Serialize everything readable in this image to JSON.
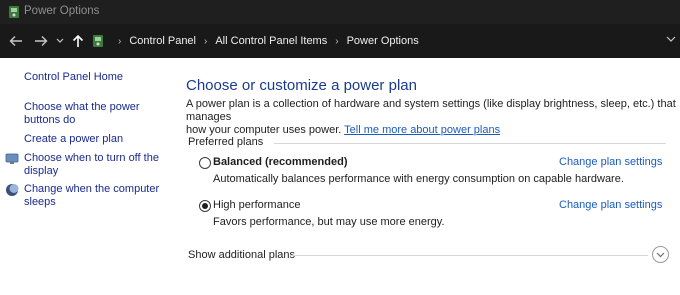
{
  "window": {
    "title": "Power Options"
  },
  "address_bar": {
    "crumbs": [
      "Control Panel",
      "All Control Panel Items",
      "Power Options"
    ]
  },
  "left_pane": {
    "home": "Control Panel Home",
    "links": [
      {
        "label_line1": "Choose what the power",
        "label_line2": "buttons do"
      },
      {
        "label_line1": "Create a power plan",
        "label_line2": ""
      },
      {
        "label_line1": "Choose when to turn off the",
        "label_line2": "display",
        "icon": "display-icon"
      },
      {
        "label_line1": "Change when the computer",
        "label_line2": "sleeps",
        "icon": "moon-sleep-icon"
      }
    ]
  },
  "main": {
    "heading": "Choose or customize a power plan",
    "description_line1": "A power plan is a collection of hardware and system settings (like display brightness, sleep, etc.) that manages",
    "description_line2": "how your computer uses power.",
    "description_link": "Tell me more about power plans",
    "preferred_label": "Preferred plans",
    "plans": [
      {
        "name": "Balanced (recommended)",
        "description": "Automatically balances performance with energy consumption on capable hardware.",
        "settings_link": "Change plan settings",
        "selected": false
      },
      {
        "name": "High performance",
        "description": "Favors performance, but may use more energy.",
        "settings_link": "Change plan settings",
        "selected": true
      }
    ],
    "additional_label": "Show additional plans"
  },
  "colors": {
    "titlebar_bg": "#1f1f1f",
    "addressbar_bg": "#191919",
    "heading": "#1a3b8f",
    "link": "#1a5bbf",
    "left_link": "#1b2a8f"
  }
}
